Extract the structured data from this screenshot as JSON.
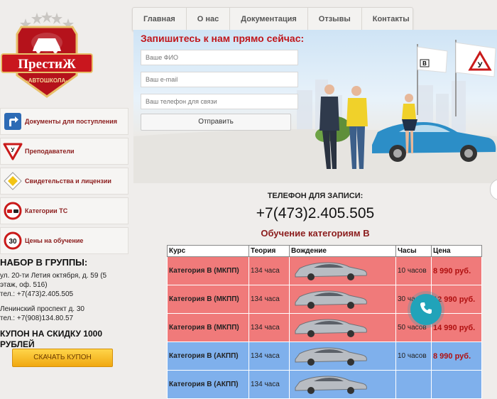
{
  "brand": {
    "name": "ПрестиЖ",
    "subtitle": "-АВТОШКОЛА-"
  },
  "nav": [
    {
      "label": "Главная"
    },
    {
      "label": "О нас"
    },
    {
      "label": "Документация"
    },
    {
      "label": "Отзывы"
    },
    {
      "label": "Контакты"
    }
  ],
  "hero": {
    "title": "Запишитесь к нам прямо сейчас:",
    "fields": {
      "name_placeholder": "Ваше ФИО",
      "email_placeholder": "Ваш e-mail",
      "phone_placeholder": "Ваш телефон для связи"
    },
    "submit_label": "Отправить",
    "sign_1": "В",
    "sign_2": "У"
  },
  "sidebar": {
    "items": [
      {
        "label": "Документы для поступления",
        "icon": "arrow-turn-icon"
      },
      {
        "label": "Преподаватели",
        "icon": "teacher-sign-icon"
      },
      {
        "label": "Свидетельства и лицензии",
        "icon": "priority-road-icon"
      },
      {
        "label": "Категории ТС",
        "icon": "no-overtaking-icon"
      },
      {
        "label": "Цены на обучение",
        "icon": "speed-limit-icon",
        "badge": "30"
      }
    ],
    "group_title": "НАБОР В ГРУППЫ:",
    "address_1_line1": "ул. 20-ти Летия октября, д. 59 (5",
    "address_1_line2": "этаж, оф. 516)",
    "address_1_phone": "тел.: +7(473)2.405.505",
    "address_2_line1": "Ленинский проспект д. 30",
    "address_2_phone": "тел.: +7(908)134.80.57",
    "coupon_title": "КУПОН НА СКИДКУ 1000 РУБЛЕЙ",
    "coupon_button": "СКАЧАТЬ КУПОН"
  },
  "contact": {
    "phone_label": "ТЕЛЕФОН ДЛЯ ЗАПИСИ:",
    "phone_number": "+7(473)2.405.505",
    "training_title": "Обучение категориям В"
  },
  "table": {
    "headers": [
      "Курс",
      "Теория",
      "Вождение",
      "Часы",
      "Цена"
    ],
    "rows": [
      {
        "course": "Категория В (МКПП)",
        "theory": "134 часа",
        "hours": "10 часов",
        "price": "8 990 руб.",
        "color": "red"
      },
      {
        "course": "Категория В (МКПП)",
        "theory": "134 часа",
        "hours": "30 часов",
        "price": "12 990 руб.",
        "color": "red"
      },
      {
        "course": "Категория В (МКПП)",
        "theory": "134 часа",
        "hours": "50 часов",
        "price": "14 990 руб.",
        "color": "red"
      },
      {
        "course": "Категория В (АКПП)",
        "theory": "134 часа",
        "hours": "10 часов",
        "price": "8 990 руб.",
        "color": "blue"
      },
      {
        "course": "Категория В (АКПП)",
        "theory": "134 часа",
        "hours": "",
        "price": "",
        "color": "blue"
      }
    ]
  },
  "colors": {
    "brand_red": "#c0171c",
    "row_red": "#f07a7a",
    "row_blue": "#7fb0ec",
    "call_button": "#21a3b9"
  }
}
